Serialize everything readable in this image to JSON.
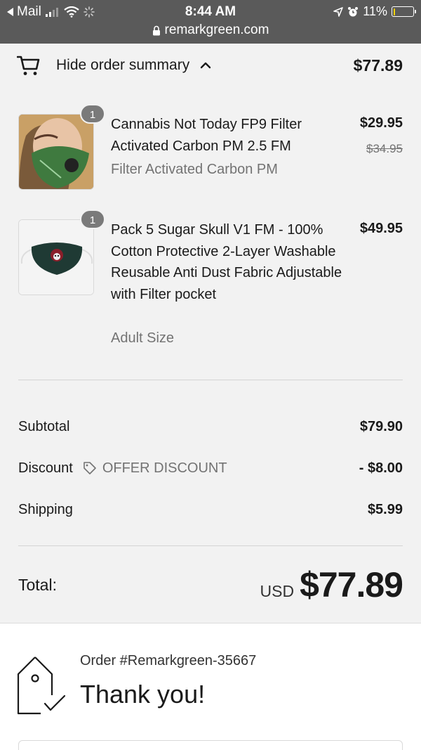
{
  "status_bar": {
    "back_app": "Mail",
    "time": "8:44 AM",
    "battery": "11%",
    "url": "remarkgreen.com"
  },
  "summary_toggle": {
    "label": "Hide order summary",
    "total": "$77.89"
  },
  "items": [
    {
      "qty": "1",
      "title": "Cannabis Not Today FP9 Filter Activated Carbon PM 2.5 FM",
      "variant": "Filter Activated Carbon PM",
      "price": "$29.95",
      "compare_price": "$34.95"
    },
    {
      "qty": "1",
      "title": "Pack 5 Sugar Skull V1 FM - 100% Cotton Protective 2-Layer Washable Reusable Anti Dust Fabric Adjustable with Filter pocket",
      "variant": "Adult Size",
      "price": "$49.95"
    }
  ],
  "totals": {
    "subtotal_label": "Subtotal",
    "subtotal": "$79.90",
    "discount_label": "Discount",
    "discount_code": "OFFER DISCOUNT",
    "discount": "- $8.00",
    "shipping_label": "Shipping",
    "shipping": "$5.99",
    "total_label": "Total:",
    "currency": "USD",
    "total": "$77.89"
  },
  "confirmation": {
    "order_number": "Order #Remarkgreen-35667",
    "heading": "Thank you!"
  },
  "colors": {
    "status_bar": "#5a5a5a",
    "summary_bg": "#f2f2f2",
    "battery": "#ffd60a",
    "muted_text": "#737373"
  }
}
